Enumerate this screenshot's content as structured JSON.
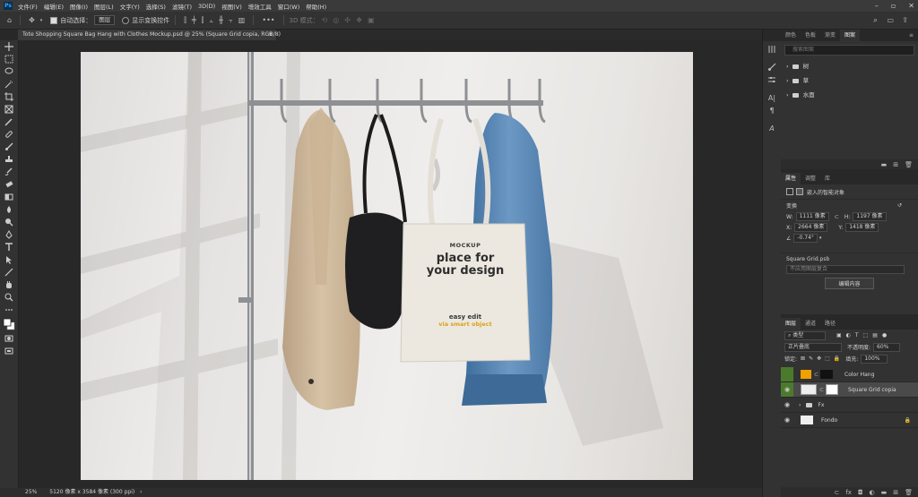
{
  "app": {
    "logo": "Ps"
  },
  "menu": [
    "文件(F)",
    "编辑(E)",
    "图像(I)",
    "图层(L)",
    "文字(Y)",
    "选择(S)",
    "滤镜(T)",
    "3D(D)",
    "视图(V)",
    "增效工具",
    "窗口(W)",
    "帮助(H)"
  ],
  "options": {
    "auto_select_label": "自动选择：",
    "auto_select_value": "图层",
    "show_transform_label": "显示变换控件",
    "mode_3d_label": "3D 模式："
  },
  "document": {
    "tab_title": "Tote Shopping Square Bag Hang with Clothes Mockup.psd @ 25% (Square Grid copia, RGB/8)",
    "close_glyph": "×"
  },
  "artwork": {
    "bag_line1": "MOCKUP",
    "bag_line2": "place for",
    "bag_line3": "your design",
    "bag_line4": "easy edit",
    "bag_line5": "via smart object"
  },
  "status": {
    "zoom": "25%",
    "doc_info": "5120 像素 x 3584 像素 (300 ppi)"
  },
  "libraries_panel": {
    "tabs": [
      "颜色",
      "色板",
      "渐变",
      "图案"
    ],
    "active_tab": "图案",
    "search_placeholder": "搜索图案",
    "groups": [
      "树",
      "草",
      "水面"
    ]
  },
  "properties_panel": {
    "tabs": [
      "属性",
      "调整",
      "库"
    ],
    "active_tab": "属性",
    "object_type": "嵌入的智能对象",
    "transform_label": "变换",
    "w_label": "W:",
    "w_value": "1111 像素",
    "h_label": "H:",
    "h_value": "1197 像素",
    "x_label": "X:",
    "x_value": "2664 像素",
    "y_label": "Y:",
    "y_value": "1418 像素",
    "angle": "-0.74°",
    "file_name": "Square Grid.psb",
    "comp_placeholder": "不应用图层复合",
    "edit_button": "编辑内容"
  },
  "layers_panel": {
    "tabs": [
      "图层",
      "通道",
      "路径"
    ],
    "active_tab": "图层",
    "filter_label": "类型",
    "blend_mode": "正片叠底",
    "opacity_label": "不透明度:",
    "opacity_value": "60%",
    "lock_label": "锁定:",
    "fill_label": "填充:",
    "fill_value": "100%",
    "layers": [
      {
        "name": "Color Hang"
      },
      {
        "name": "Square Grid copia"
      },
      {
        "name": "Fx"
      },
      {
        "name": "Fondo"
      }
    ]
  },
  "colors": {
    "accent": "#31a8ff",
    "tote_orange": "#d9a21b",
    "layer_green": "#4c7a2d"
  }
}
